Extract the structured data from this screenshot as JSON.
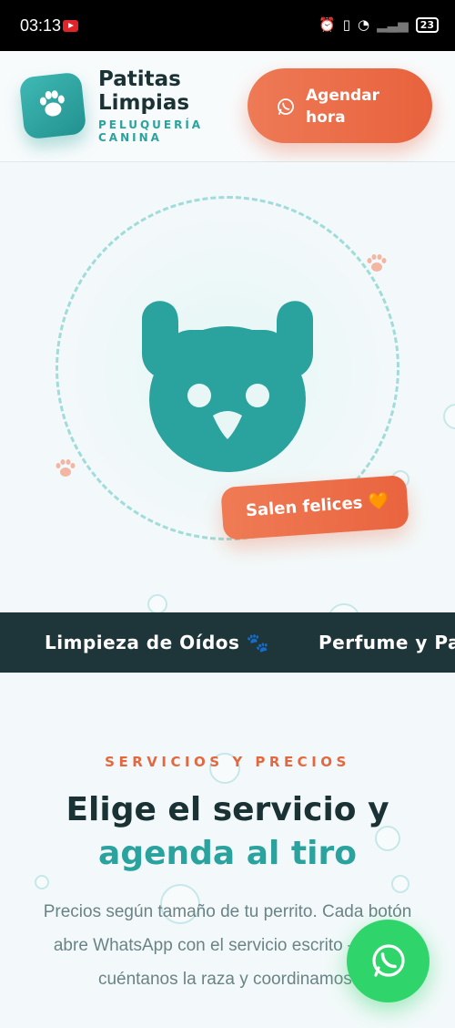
{
  "status_bar": {
    "time": "03:13",
    "battery": "23"
  },
  "header": {
    "brand_name": "Patitas Limpias",
    "brand_tagline": "PELUQUERÍA CANINA",
    "cta_label": "Agendar hora"
  },
  "hero": {
    "badge": "Salen felices 🧡"
  },
  "marquee": {
    "items": [
      "Limpieza de Oídos",
      "Perfume y Pa"
    ]
  },
  "services": {
    "eyebrow": "SERVICIOS Y PRECIOS",
    "heading_line1": "Elige el servicio y",
    "heading_line2": "agenda al tiro",
    "description": "Precios según tamaño de tu perrito. Cada botón abre WhatsApp con el servicio escrito — solo cuéntanos la raza y coordinamos."
  },
  "colors": {
    "teal": "#2aa29e",
    "orange": "#e8623d",
    "dark": "#1e3639",
    "whatsapp": "#2fd56a"
  }
}
